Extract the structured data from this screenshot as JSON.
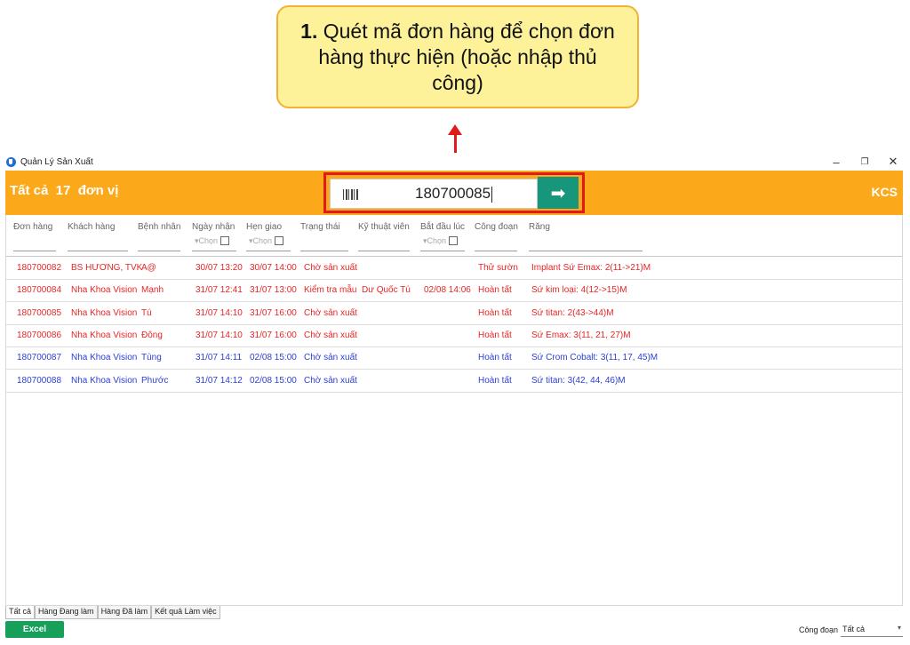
{
  "callout": {
    "number": "1.",
    "text": " Quét mã đơn hàng để chọn đơn hàng thực hiện (hoặc nhập thủ công)"
  },
  "window": {
    "title": "Quản Lý Sản Xuất",
    "minimize": "–",
    "restore": "❐",
    "close": "✕"
  },
  "header": {
    "left_text": "Tất cả  17  đơn vị",
    "right_text": "KCS",
    "scan_value": "180700085",
    "go_icon": "arrow-right-icon"
  },
  "columns": [
    "Đơn hàng",
    "Khách hàng",
    "Bệnh nhân",
    "Ngày nhận",
    "Hẹn giao",
    "Trạng thái",
    "Kỹ thuật viên",
    "Bắt đầu lúc",
    "Công đoạn",
    "Răng"
  ],
  "filter_placeholder": "Chọn",
  "rows": [
    {
      "color": "red",
      "order": "180700082",
      "customer": "BS HƯƠNG, TVK",
      "patient": "A@",
      "received": "30/07 13:20",
      "due": "30/07 14:00",
      "status": "Chờ sản xuất",
      "technician": "",
      "start": "",
      "stage": "Thử sườn",
      "teeth": "Implant Sứ Emax: 2(11->21)M"
    },
    {
      "color": "red",
      "order": "180700084",
      "customer": "Nha Khoa Vision",
      "patient": "Mạnh",
      "received": "31/07 12:41",
      "due": "31/07 13:00",
      "status": "Kiểm tra mẫu",
      "technician": "Dư Quốc Tú",
      "start": "02/08 14:06",
      "stage": "Hoàn tất",
      "teeth": "Sứ kim loại: 4(12->15)M"
    },
    {
      "color": "red",
      "order": "180700085",
      "customer": "Nha Khoa Vision",
      "patient": "Tú",
      "received": "31/07 14:10",
      "due": "31/07 16:00",
      "status": "Chờ sản xuất",
      "technician": "",
      "start": "",
      "stage": "Hoàn tất",
      "teeth": "Sứ titan: 2(43->44)M"
    },
    {
      "color": "red",
      "order": "180700086",
      "customer": "Nha Khoa Vision",
      "patient": "Đông",
      "received": "31/07 14:10",
      "due": "31/07 16:00",
      "status": "Chờ sản xuất",
      "technician": "",
      "start": "",
      "stage": "Hoàn tất",
      "teeth": "Sứ Emax: 3(11, 21, 27)M"
    },
    {
      "color": "blue",
      "order": "180700087",
      "customer": "Nha Khoa Vision",
      "patient": "Tùng",
      "received": "31/07 14:11",
      "due": "02/08 15:00",
      "status": "Chờ sản xuất",
      "technician": "",
      "start": "",
      "stage": "Hoàn tất",
      "teeth": "Sứ Crom Cobalt: 3(11, 17, 45)M"
    },
    {
      "color": "blue",
      "order": "180700088",
      "customer": "Nha Khoa Vision",
      "patient": "Phước",
      "received": "31/07 14:12",
      "due": "02/08 15:00",
      "status": "Chờ sản xuất",
      "technician": "",
      "start": "",
      "stage": "Hoàn tất",
      "teeth": "Sứ titan: 3(42, 44, 46)M"
    }
  ],
  "tabs": [
    "Tất cả",
    "Hàng Đang làm",
    "Hàng Đã làm",
    "Kết quả Làm việc"
  ],
  "footer": {
    "excel_label": "Excel",
    "stage_label": "Công đoạn",
    "stage_value": "Tất cả"
  },
  "colors": {
    "orange": "#fba91a",
    "green": "#16967a",
    "red_text": "#e82525",
    "blue_text": "#2b3fd6",
    "highlight": "#e01b1b",
    "callout_bg": "#fdf29a"
  }
}
